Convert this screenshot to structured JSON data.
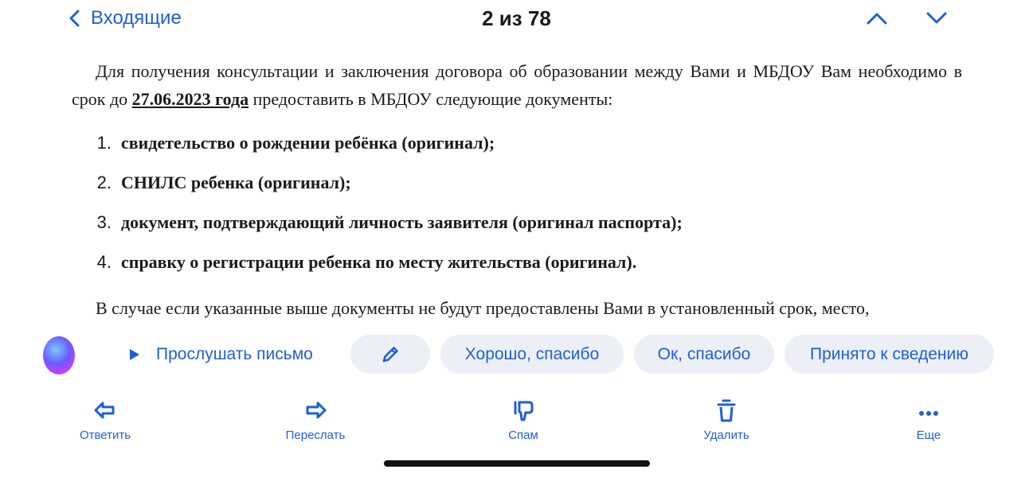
{
  "header": {
    "back_label": "Входящие",
    "counter": "2 из 78"
  },
  "email": {
    "para1_before": "Для получения консультации и заключения договора об образовании между Вами и МБДОУ Вам необходимо в срок до ",
    "deadline": "27.06.2023 года",
    "para1_after": " предоставить в МБДОУ следующие документы:",
    "documents": [
      {
        "num": "1.",
        "text": "свидетельство о рождении ребёнка (оригинал);"
      },
      {
        "num": "2.",
        "text": "СНИЛС ребенка (оригинал);"
      },
      {
        "num": "3.",
        "text": "документ, подтверждающий личность заявителя (оригинал паспорта);"
      },
      {
        "num": "4.",
        "text": "справку о регистрации ребенка по месту жительства (оригинал)."
      }
    ],
    "para2": "В случае если указанные выше документы не будут предоставлены Вами в установленный срок, место,"
  },
  "chips": {
    "listen": "Прослушать письмо",
    "reply_good": "Хорошо, спасибо",
    "reply_ok": "Ок, спасибо",
    "reply_noted": "Принято к сведению"
  },
  "toolbar": {
    "reply": "Ответить",
    "forward": "Переслать",
    "spam": "Спам",
    "delete": "Удалить",
    "more": "Еще"
  },
  "colors": {
    "accent": "#1f5fd6",
    "chip_bg": "#ecf0f6",
    "text": "#1a1a1a"
  },
  "icons": {
    "back": "chevron-left-icon",
    "prev": "chevron-up-icon",
    "next": "chevron-down-icon",
    "listen": "play-icon",
    "edit": "pencil-icon",
    "reply": "reply-icon",
    "forward": "forward-icon",
    "spam": "thumbs-down-icon",
    "delete": "trash-icon",
    "more": "more-dots-icon"
  }
}
